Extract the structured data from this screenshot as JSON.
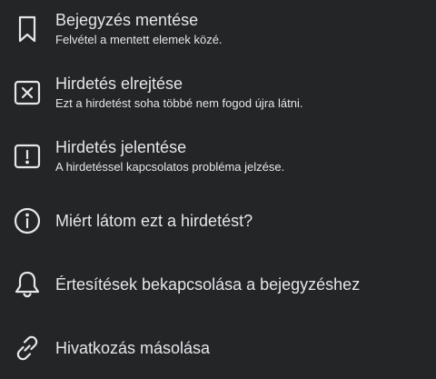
{
  "menu": {
    "items": [
      {
        "icon": "bookmark-icon",
        "title": "Bejegyzés mentése",
        "subtitle": "Felvétel a mentett elemek közé."
      },
      {
        "icon": "close-box-icon",
        "title": "Hirdetés elrejtése",
        "subtitle": "Ezt a hirdetést soha többé nem fogod újra látni."
      },
      {
        "icon": "report-alert-icon",
        "title": "Hirdetés jelentése",
        "subtitle": "A hirdetéssel kapcsolatos probléma jelzése."
      },
      {
        "icon": "info-icon",
        "title": "Miért látom ezt a hirdetést?"
      },
      {
        "icon": "bell-icon",
        "title": "Értesítések bekapcsolása a bejegyzéshez"
      },
      {
        "icon": "link-icon",
        "title": "Hivatkozás másolása"
      }
    ]
  },
  "colors": {
    "background": "#242526",
    "text": "#e4e6eb"
  }
}
